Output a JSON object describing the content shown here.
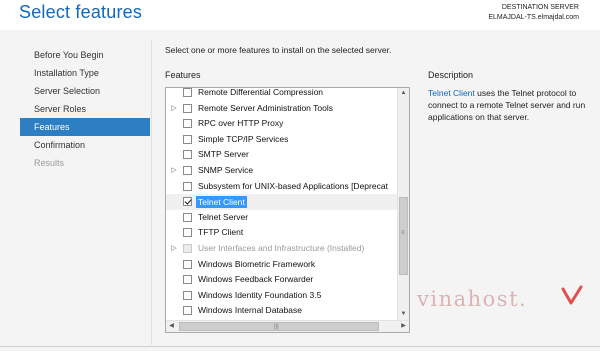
{
  "header": {
    "title": "Select features",
    "destination_label": "DESTINATION SERVER",
    "destination_server": "ELMAJDAL-TS.elmajdal.com"
  },
  "nav": {
    "items": [
      {
        "label": "Before You Begin",
        "state": "normal"
      },
      {
        "label": "Installation Type",
        "state": "normal"
      },
      {
        "label": "Server Selection",
        "state": "normal"
      },
      {
        "label": "Server Roles",
        "state": "normal"
      },
      {
        "label": "Features",
        "state": "active"
      },
      {
        "label": "Confirmation",
        "state": "normal"
      },
      {
        "label": "Results",
        "state": "disabled"
      }
    ]
  },
  "main": {
    "intro": "Select one or more features to install on the selected server.",
    "features_heading": "Features",
    "description_heading": "Description",
    "features": [
      {
        "label": "Remote Differential Compression",
        "checked": false,
        "expandable": false,
        "disabled": false
      },
      {
        "label": "Remote Server Administration Tools",
        "checked": false,
        "expandable": true,
        "disabled": false
      },
      {
        "label": "RPC over HTTP Proxy",
        "checked": false,
        "expandable": false,
        "disabled": false
      },
      {
        "label": "Simple TCP/IP Services",
        "checked": false,
        "expandable": false,
        "disabled": false
      },
      {
        "label": "SMTP Server",
        "checked": false,
        "expandable": false,
        "disabled": false
      },
      {
        "label": "SNMP Service",
        "checked": false,
        "expandable": true,
        "disabled": false
      },
      {
        "label": "Subsystem for UNIX-based Applications [Deprecat",
        "checked": false,
        "expandable": false,
        "disabled": false
      },
      {
        "label": "Telnet Client",
        "checked": true,
        "expandable": false,
        "disabled": false,
        "selected": true
      },
      {
        "label": "Telnet Server",
        "checked": false,
        "expandable": false,
        "disabled": false
      },
      {
        "label": "TFTP Client",
        "checked": false,
        "expandable": false,
        "disabled": false
      },
      {
        "label": "User Interfaces and Infrastructure (Installed)",
        "checked": false,
        "expandable": true,
        "disabled": true
      },
      {
        "label": "Windows Biometric Framework",
        "checked": false,
        "expandable": false,
        "disabled": false
      },
      {
        "label": "Windows Feedback Forwarder",
        "checked": false,
        "expandable": false,
        "disabled": false
      },
      {
        "label": "Windows Identity Foundation 3.5",
        "checked": false,
        "expandable": false,
        "disabled": false
      },
      {
        "label": "Windows Internal Database",
        "checked": false,
        "expandable": false,
        "disabled": false
      }
    ],
    "description": {
      "link": "Telnet Client",
      "text": " uses the Telnet protocol to connect to a remote Telnet server and run applications on that server."
    }
  },
  "watermark": {
    "text": "vinahost."
  },
  "colors": {
    "accent": "#0f68c4",
    "nav_active": "#2d7fc4",
    "selection": "#3399ff"
  }
}
